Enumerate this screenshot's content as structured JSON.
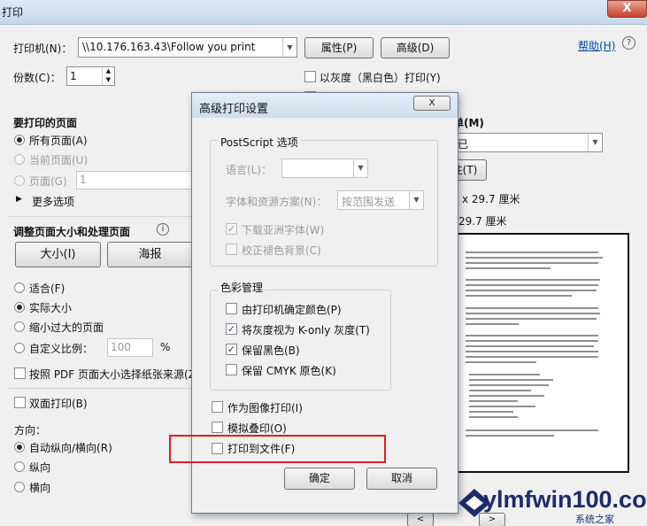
{
  "window": {
    "title": "打印",
    "close_glyph": "X"
  },
  "printer": {
    "label": "打印机(N)：",
    "value": "\\\\10.176.163.43\\Follow you print",
    "properties_btn": "属性(P)",
    "advanced_btn": "高级(D)",
    "help_link": "帮助(H)"
  },
  "copies": {
    "label": "份数(C)：",
    "value": "1"
  },
  "grayscale": {
    "label": "以灰度（黑白色）打印(Y)"
  },
  "pages": {
    "header": "要打印的页面",
    "all": "所有页面(A)",
    "current": "当前页面(U)",
    "range": "页面(G)",
    "range_value": "1",
    "more": "更多选项"
  },
  "sizing": {
    "header": "调整页面大小和处理页面",
    "size_btn": "大小(I)",
    "poster_btn": "海报",
    "fit": "适合(F)",
    "actual": "实际大小",
    "shrink": "缩小过大的页面",
    "custom": "自定义比例：",
    "custom_value": "100",
    "percent": "%",
    "pdf_paper": "按照 PDF 页面大小选择纸张来源(Z"
  },
  "duplex": {
    "label": "双面打印(B)"
  },
  "orientation": {
    "label": "方向：",
    "auto": "自动纵向/横向(R)",
    "portrait": "纵向",
    "landscape": "横向"
  },
  "right": {
    "header_fragment": "单(M)",
    "combo_value": "已",
    "btn_fragment": "注(T)",
    "size1": "x 29.7 厘米",
    "size2": "29.7 厘米"
  },
  "dialog": {
    "title": "高级打印设置",
    "postscript": {
      "legend": "PostScript 选项",
      "language_label": "语言(L)：",
      "font_label": "字体和资源方案(N)：",
      "font_value": "按范围发送",
      "download_asian": "下载亚洲字体(W)",
      "correct_bg": "校正褪色背景(C)"
    },
    "color": {
      "legend": "色彩管理",
      "printer_color": "由打印机确定颜色(P)",
      "gray_konly": "将灰度视为 K-only 灰度(T)",
      "keep_black": "保留黑色(B)",
      "keep_cmyk": "保留 CMYK 原色(K)"
    },
    "print_as_image": "作为图像打印(I)",
    "simulate_overprint": "模拟叠印(O)",
    "print_to_file": "打印到文件(F)",
    "ok": "确定",
    "cancel": "取消",
    "close_glyph": "X"
  },
  "watermark": {
    "text": "ylmfwin100.com",
    "sub": "系统之家"
  },
  "colors": {
    "accent_link": "#0645ad",
    "highlight": "#e51c23",
    "watermark": "#1b2b6b"
  }
}
